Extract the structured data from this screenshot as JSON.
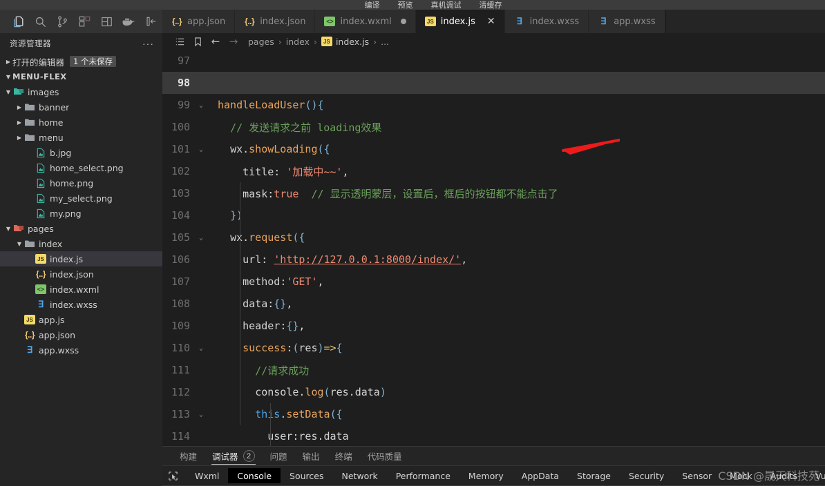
{
  "menubar": {
    "items": [
      "编译",
      "预览",
      "真机调试",
      "清缓存"
    ]
  },
  "activitybar": {
    "icons": [
      {
        "name": "explorer-icon",
        "label": "资源管理器"
      },
      {
        "name": "search-icon",
        "label": "搜索"
      },
      {
        "name": "source-control-icon",
        "label": "源代码管理"
      },
      {
        "name": "extensions-icon",
        "label": "扩展"
      },
      {
        "name": "layout-panel-icon",
        "label": "面板"
      },
      {
        "name": "docker-icon",
        "label": "Docker"
      },
      {
        "name": "collapse-sidebar-icon",
        "label": "折叠侧边栏"
      }
    ]
  },
  "explorer": {
    "title": "资源管理器",
    "more_label": "···",
    "open_editors": {
      "label": "打开的编辑器",
      "badge": "1 个未保存"
    },
    "project_name": "MENU-FLEX",
    "tree": [
      {
        "label": "images",
        "depth": 1,
        "type": "folder-img",
        "expanded": true,
        "selected": false
      },
      {
        "label": "banner",
        "depth": 2,
        "type": "folder",
        "expanded": false,
        "selected": false
      },
      {
        "label": "home",
        "depth": 2,
        "type": "folder",
        "expanded": false,
        "selected": false
      },
      {
        "label": "menu",
        "depth": 2,
        "type": "folder",
        "expanded": false,
        "selected": false
      },
      {
        "label": "b.jpg",
        "depth": 3,
        "type": "image",
        "expanded": null,
        "selected": false
      },
      {
        "label": "home_select.png",
        "depth": 3,
        "type": "image",
        "expanded": null,
        "selected": false
      },
      {
        "label": "home.png",
        "depth": 3,
        "type": "image",
        "expanded": null,
        "selected": false
      },
      {
        "label": "my_select.png",
        "depth": 3,
        "type": "image",
        "expanded": null,
        "selected": false
      },
      {
        "label": "my.png",
        "depth": 3,
        "type": "image",
        "expanded": null,
        "selected": false
      },
      {
        "label": "pages",
        "depth": 1,
        "type": "folder-pages",
        "expanded": true,
        "selected": false
      },
      {
        "label": "index",
        "depth": 2,
        "type": "folder",
        "expanded": true,
        "selected": false
      },
      {
        "label": "index.js",
        "depth": 3,
        "type": "js",
        "expanded": null,
        "selected": true
      },
      {
        "label": "index.json",
        "depth": 3,
        "type": "json",
        "expanded": null,
        "selected": false
      },
      {
        "label": "index.wxml",
        "depth": 3,
        "type": "wxml",
        "expanded": null,
        "selected": false
      },
      {
        "label": "index.wxss",
        "depth": 3,
        "type": "wxss",
        "expanded": null,
        "selected": false
      },
      {
        "label": "app.js",
        "depth": 2,
        "type": "js",
        "expanded": null,
        "selected": false
      },
      {
        "label": "app.json",
        "depth": 2,
        "type": "json",
        "expanded": null,
        "selected": false
      },
      {
        "label": "app.wxss",
        "depth": 2,
        "type": "wxss",
        "expanded": null,
        "selected": false
      }
    ]
  },
  "tabs": [
    {
      "label": "app.json",
      "type": "json",
      "active": false,
      "dirty": false,
      "closable": false
    },
    {
      "label": "index.json",
      "type": "json",
      "active": false,
      "dirty": false,
      "closable": false
    },
    {
      "label": "index.wxml",
      "type": "wxml",
      "active": false,
      "dirty": true,
      "closable": false
    },
    {
      "label": "index.js",
      "type": "js",
      "active": true,
      "dirty": false,
      "closable": true
    },
    {
      "label": "index.wxss",
      "type": "wxss",
      "active": false,
      "dirty": false,
      "closable": false
    },
    {
      "label": "app.wxss",
      "type": "wxss",
      "active": false,
      "dirty": false,
      "closable": false
    }
  ],
  "tab_close_glyph": "✕",
  "breadcrumb": {
    "back_glyph": "←",
    "forward_glyph": "→",
    "separator": "›",
    "items": [
      "pages",
      "index",
      "index.js",
      "..."
    ]
  },
  "editor": {
    "language": "javascript",
    "active_line": 98,
    "lines": [
      {
        "num": 97,
        "fold": "",
        "active": false,
        "text": ""
      },
      {
        "num": 98,
        "fold": "",
        "active": true,
        "text": ""
      },
      {
        "num": 99,
        "fold": "⌄",
        "active": false,
        "text": "handleLoadUser(){"
      },
      {
        "num": 100,
        "fold": "",
        "active": false,
        "text": "  // 发送请求之前 loading效果"
      },
      {
        "num": 101,
        "fold": "⌄",
        "active": false,
        "text": "  wx.showLoading({"
      },
      {
        "num": 102,
        "fold": "",
        "active": false,
        "text": "    title: '加载中~~',"
      },
      {
        "num": 103,
        "fold": "",
        "active": false,
        "text": "    mask:true  // 显示透明蒙层，设置后，框后的按钮都不能点击了"
      },
      {
        "num": 104,
        "fold": "",
        "active": false,
        "text": "  })"
      },
      {
        "num": 105,
        "fold": "⌄",
        "active": false,
        "text": "  wx.request({"
      },
      {
        "num": 106,
        "fold": "",
        "active": false,
        "text": "    url: 'http://127.0.0.1:8000/index/',"
      },
      {
        "num": 107,
        "fold": "",
        "active": false,
        "text": "    method:'GET',"
      },
      {
        "num": 108,
        "fold": "",
        "active": false,
        "text": "    data:{},"
      },
      {
        "num": 109,
        "fold": "",
        "active": false,
        "text": "    header:{},"
      },
      {
        "num": 110,
        "fold": "⌄",
        "active": false,
        "text": "    success:(res)=>{"
      },
      {
        "num": 111,
        "fold": "",
        "active": false,
        "text": "      //请求成功"
      },
      {
        "num": 112,
        "fold": "",
        "active": false,
        "text": "      console.log(res.data)"
      },
      {
        "num": 113,
        "fold": "⌄",
        "active": false,
        "text": "      this.setData({"
      },
      {
        "num": 114,
        "fold": "",
        "active": false,
        "text": "        user:res.data"
      }
    ]
  },
  "annotation": {
    "type": "red-arrow",
    "color": "#ef1b1b",
    "points_to": "handleLoadUser(){"
  },
  "panel": {
    "tabs": [
      {
        "label": "构建",
        "active": false,
        "count": null
      },
      {
        "label": "调试器",
        "active": true,
        "count": "2"
      },
      {
        "label": "问题",
        "active": false,
        "count": null
      },
      {
        "label": "输出",
        "active": false,
        "count": null
      },
      {
        "label": "终端",
        "active": false,
        "count": null
      },
      {
        "label": "代码质量",
        "active": false,
        "count": null
      }
    ]
  },
  "devtools": {
    "picker_icon": "element-picker-icon",
    "tabs": [
      {
        "label": "Wxml",
        "active": false
      },
      {
        "label": "Console",
        "active": true
      },
      {
        "label": "Sources",
        "active": false
      },
      {
        "label": "Network",
        "active": false
      },
      {
        "label": "Performance",
        "active": false
      },
      {
        "label": "Memory",
        "active": false
      },
      {
        "label": "AppData",
        "active": false
      },
      {
        "label": "Storage",
        "active": false
      },
      {
        "label": "Security",
        "active": false
      },
      {
        "label": "Sensor",
        "active": false
      },
      {
        "label": "Mock",
        "active": false
      },
      {
        "label": "Audits",
        "active": false
      },
      {
        "label": "Vulnerability",
        "active": false
      }
    ]
  },
  "watermark": {
    "text": "CSDN @晟天科技苑"
  },
  "colors": {
    "editor_bg": "#1e1e1e",
    "sidebar_bg": "#252526",
    "activitybar_bg": "#333333",
    "tab_active_bg": "#1e1e1e",
    "tab_inactive_bg": "#2d2d2d",
    "accent_red": "#ef1b1b",
    "string": "#f08a72",
    "comment": "#6aa05a",
    "function": "#e8a45c",
    "keyword": "#569cd6"
  }
}
